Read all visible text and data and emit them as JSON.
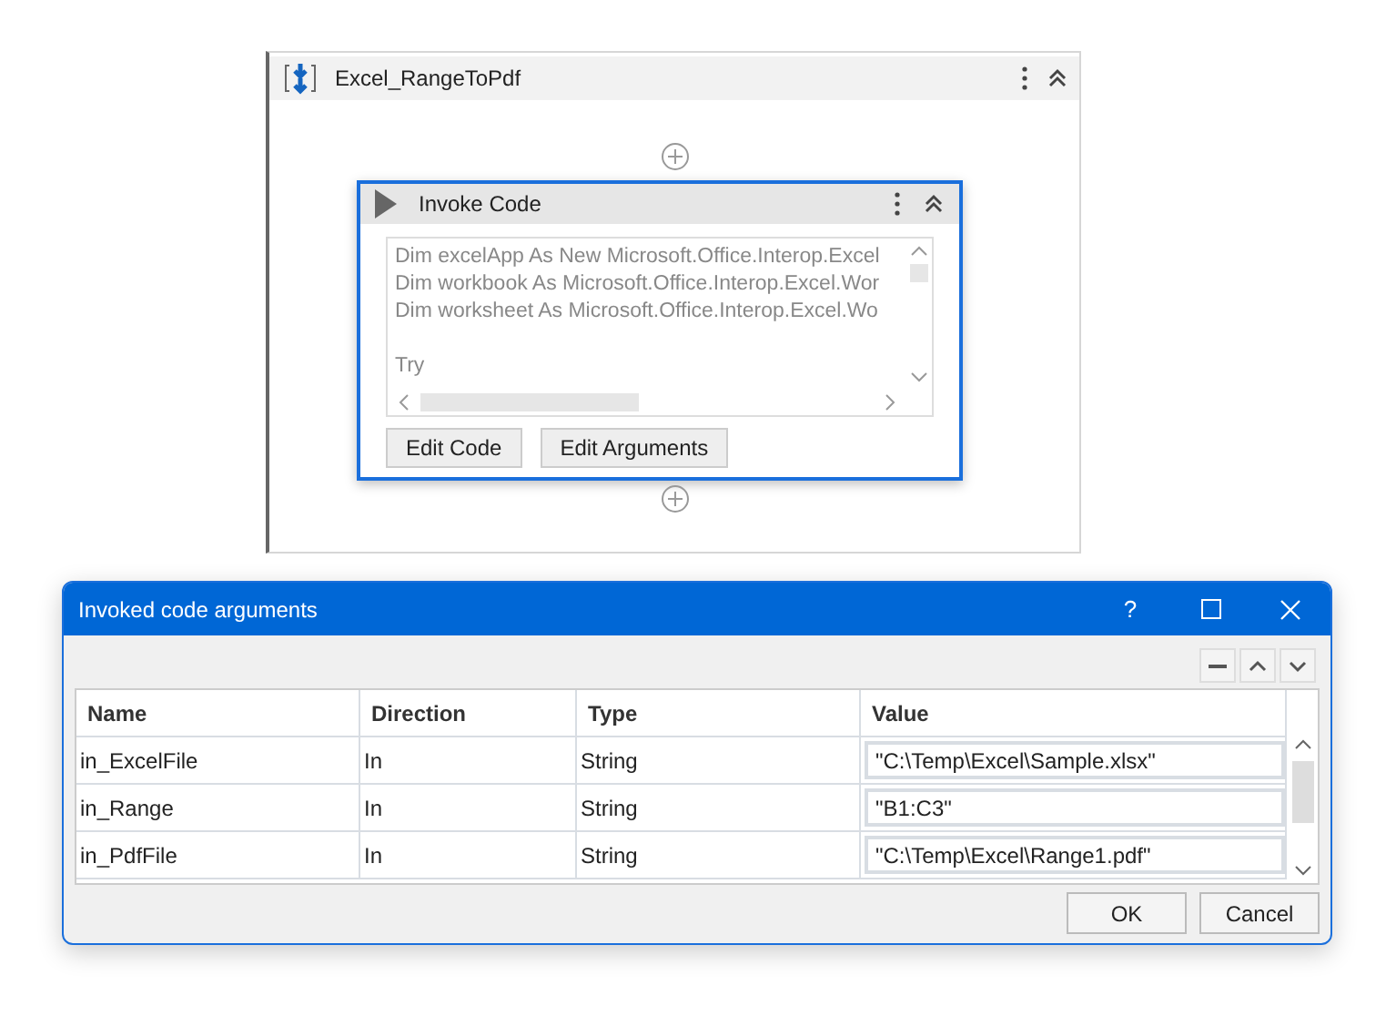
{
  "sequence": {
    "title": "Excel_RangeToPdf"
  },
  "activity": {
    "title": "Invoke Code",
    "code_blocks": [
      {
        "lines": [
          "Dim excelApp As New Microsoft.Office.Interop.Excel",
          "Dim workbook As Microsoft.Office.Interop.Excel.Wor",
          "Dim worksheet As Microsoft.Office.Interop.Excel.Wo"
        ]
      },
      {
        "lines": [
          "Try"
        ]
      }
    ],
    "buttons": [
      "Edit Code",
      "Edit Arguments"
    ]
  },
  "dialog": {
    "title": "Invoked code arguments",
    "title_buttons": [
      "?"
    ],
    "columns": [
      "Name",
      "Direction",
      "Type",
      "Value"
    ],
    "rows": [
      {
        "name": "in_ExcelFile",
        "direction": "In",
        "type": "String",
        "value": "\"C:\\Temp\\Excel\\Sample.xlsx\""
      },
      {
        "name": "in_Range",
        "direction": "In",
        "type": "String",
        "value": "\"B1:C3\""
      },
      {
        "name": "in_PdfFile",
        "direction": "In",
        "type": "String",
        "value": "\"C:\\Temp\\Excel\\Range1.pdf\""
      }
    ],
    "buttons": [
      "OK",
      "Cancel"
    ]
  }
}
